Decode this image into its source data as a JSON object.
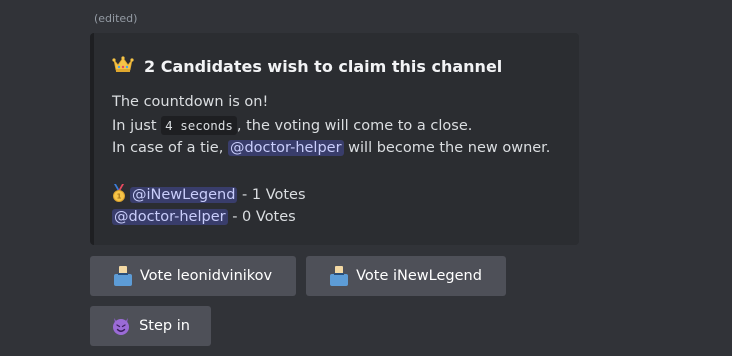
{
  "message": {
    "edited_label": "(edited)"
  },
  "embed": {
    "title_icon": "crown-icon",
    "title": "2 Candidates wish to claim this channel",
    "line1": "The countdown is on!",
    "line2_prefix": "In just ",
    "line2_code": "4 seconds",
    "line2_suffix": ", the voting will come to a close.",
    "line3_prefix": "In case of a tie, ",
    "line3_mention": "@doctor-helper",
    "line3_suffix": " will become the new owner.",
    "votes": [
      {
        "icon": "first-place-medal-icon",
        "mention": "@iNewLegend",
        "text": " - 1 Votes"
      },
      {
        "icon": "",
        "mention": "@doctor-helper",
        "text": " - 0 Votes"
      }
    ]
  },
  "buttons": {
    "vote1": {
      "icon": "ballot-box-icon",
      "label": "Vote leonidvinikov"
    },
    "vote2": {
      "icon": "ballot-box-icon",
      "label": "Vote iNewLegend"
    },
    "step_in": {
      "icon": "smiling-devil-icon",
      "label": "Step in"
    }
  },
  "colors": {
    "background": "#313338",
    "embed_background": "#2b2d31",
    "button": "#4e5058",
    "mention_text": "#c9cdfb"
  }
}
